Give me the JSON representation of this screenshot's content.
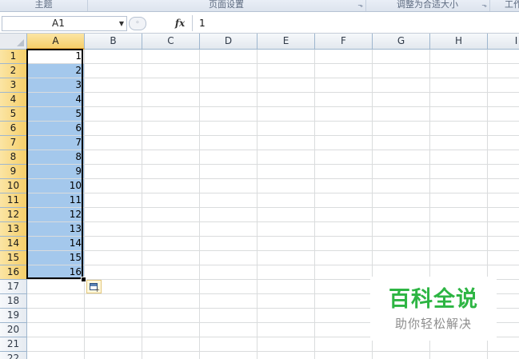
{
  "ribbon": {
    "groups": [
      {
        "label": "主题",
        "launcher": false
      },
      {
        "label": "页面设置",
        "launcher": true
      },
      {
        "label": "调整为合适大小",
        "launcher": true
      },
      {
        "label": "工作",
        "launcher": false
      }
    ]
  },
  "formula_bar": {
    "name_box": "A1",
    "fx_label": "fx",
    "content": "1"
  },
  "sheet": {
    "columns": [
      "A",
      "B",
      "C",
      "D",
      "E",
      "F",
      "G",
      "H",
      "I"
    ],
    "rows": [
      "1",
      "2",
      "3",
      "4",
      "5",
      "6",
      "7",
      "8",
      "9",
      "10",
      "11",
      "12",
      "13",
      "14",
      "15",
      "16",
      "17",
      "18",
      "19",
      "20",
      "21",
      "22"
    ],
    "active_column": "A",
    "selection": "A1:A16",
    "column_a_values": [
      "1",
      "2",
      "3",
      "4",
      "5",
      "6",
      "7",
      "8",
      "9",
      "10",
      "11",
      "12",
      "13",
      "14",
      "15",
      "16"
    ]
  },
  "colors": {
    "selection_fill": "#a4c8ec",
    "header_active": "#f6cf6a",
    "watermark_green": "#2db543"
  },
  "watermark": {
    "title": "百科全说",
    "subtitle": "助你轻松解决"
  }
}
